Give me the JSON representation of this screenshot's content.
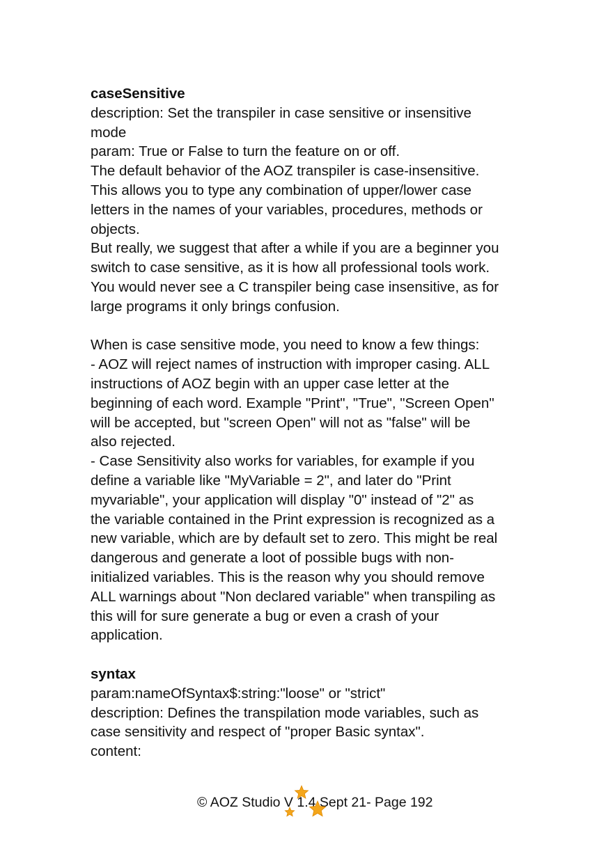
{
  "sections": [
    {
      "heading": "caseSensitive",
      "lines": [
        "description: Set the transpiler in case sensitive or insensitive",
        "mode",
        "param: True or False to turn the feature on or off.",
        "The default behavior of the AOZ transpiler is case-insensitive.",
        "This allows you to type any combination of upper/lower case",
        "letters in the names of your variables, procedures, methods or",
        "objects.",
        "But really, we suggest that after a while if you are a beginner you",
        "switch to case sensitive, as it is how all professional tools work.",
        "You would never see a C transpiler being case insensitive, as for",
        "large programs it only brings confusion.",
        "",
        "When is case sensitive mode, you need to know a few things:",
        "- AOZ will reject names of instruction with improper casing. ALL",
        "instructions of AOZ begin with an upper case letter at the",
        "beginning of each word. Example \"Print\", \"True\", \"Screen Open\"",
        "will be accepted, but \"screen Open\" will not as \"false\" will be",
        "also rejected.",
        "- Case Sensitivity also works for variables, for example if you",
        "define a variable like \"MyVariable = 2\", and later do \"Print",
        "myvariable\", your application will display \"0\" instead of \"2\" as",
        "the variable contained in the Print expression is recognized as a",
        "new variable, which are by default set to zero. This might be real",
        "dangerous and generate a loot of possible bugs with non-",
        "initialized variables. This is the reason why you should remove",
        "ALL warnings about \"Non declared variable\" when transpiling as",
        "this will for sure generate a bug or even a crash of your",
        "application.",
        ""
      ]
    },
    {
      "heading": "syntax",
      "lines": [
        "param:nameOfSyntax$:string:\"loose\" or \"strict\"",
        "description: Defines the transpilation mode variables, such as",
        "case sensitivity and respect of \"proper Basic syntax\".",
        "content:"
      ]
    }
  ],
  "footer": {
    "text": "© AOZ Studio V 1.4 Sept 21- Page 192",
    "logo_icon": "aoz-stars-logo-icon",
    "logo_color": "#f4a61b"
  }
}
